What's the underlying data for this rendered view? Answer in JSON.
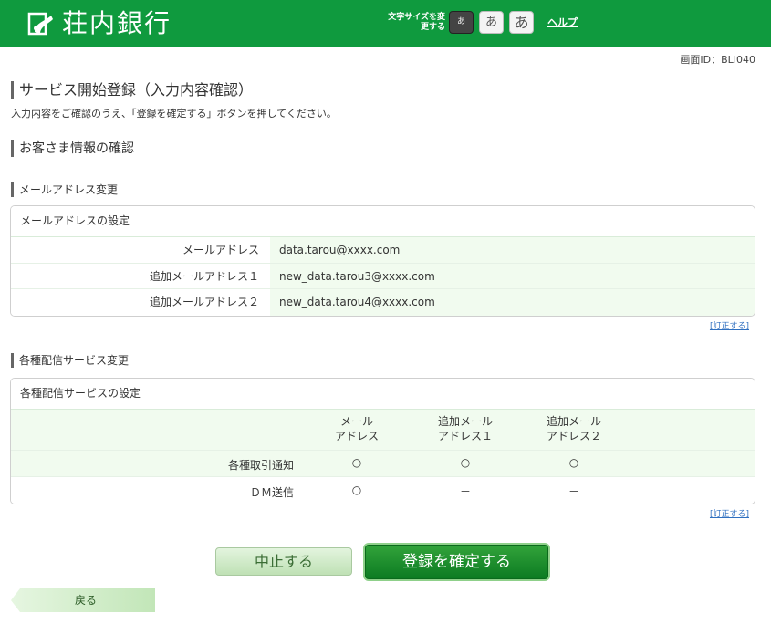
{
  "header": {
    "bank_name": "荘内銀行",
    "font_size_label": "文字サイズを変更する",
    "font_sizes": [
      "あ",
      "あ",
      "あ"
    ],
    "help_label": "ヘルプ"
  },
  "screen_id": "画面ID：BLI040",
  "page": {
    "title": "サービス開始登録（入力内容確認）",
    "instruction": "入力内容をご確認のうえ、「登録を確定する」ボタンを押してください。"
  },
  "customer_section": {
    "heading": "お客さま情報の確認"
  },
  "mail_section": {
    "heading": "メールアドレス変更",
    "panel_title": "メールアドレスの設定",
    "rows": [
      {
        "label": "メールアドレス",
        "value": "data.tarou@xxxx.com"
      },
      {
        "label": "追加メールアドレス１",
        "value": "new_data.tarou3@xxxx.com"
      },
      {
        "label": "追加メールアドレス２",
        "value": "new_data.tarou4@xxxx.com"
      }
    ],
    "correct_link": "[訂正する]"
  },
  "delivery_section": {
    "heading": "各種配信サービス変更",
    "panel_title": "各種配信サービスの設定",
    "columns": [
      {
        "line1": "メール",
        "line2": "アドレス"
      },
      {
        "line1": "追加メール",
        "line2": "アドレス１"
      },
      {
        "line1": "追加メール",
        "line2": "アドレス２"
      }
    ],
    "rows": [
      {
        "label": "各種取引通知",
        "values": [
          "○",
          "○",
          "○"
        ]
      },
      {
        "label": "ＤＭ送信",
        "values": [
          "○",
          "－",
          "－"
        ]
      }
    ],
    "correct_link": "[訂正する]"
  },
  "buttons": {
    "cancel": "中止する",
    "confirm": "登録を確定する",
    "back": "戻る"
  },
  "colors": {
    "header_bg": "#0f9a3e",
    "row_highlight": "#f1fbef",
    "link": "#3070c0"
  }
}
